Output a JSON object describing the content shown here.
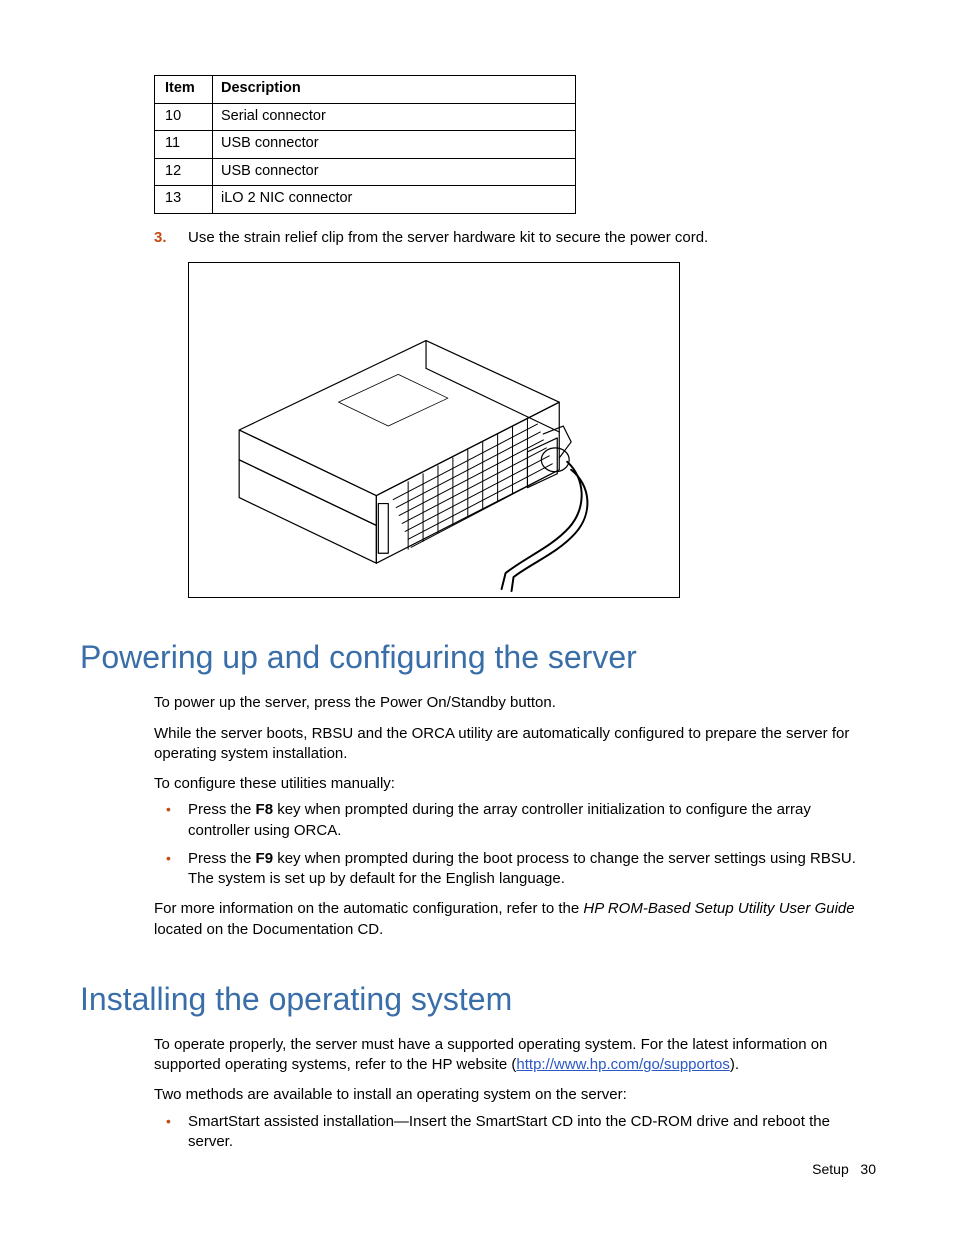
{
  "table": {
    "headers": {
      "item": "Item",
      "description": "Description"
    },
    "rows": [
      {
        "item": "10",
        "description": "Serial connector"
      },
      {
        "item": "11",
        "description": "USB connector"
      },
      {
        "item": "12",
        "description": "USB connector"
      },
      {
        "item": "13",
        "description": "iLO 2 NIC connector"
      }
    ]
  },
  "step3": {
    "num": "3.",
    "text": "Use the strain relief clip from the server hardware kit to secure the power cord."
  },
  "section1": {
    "title": "Powering up and configuring the server",
    "p1": "To power up the server, press the Power On/Standby button.",
    "p2": "While the server boots, RBSU and the ORCA utility are automatically configured to prepare the server for operating system installation.",
    "p3": "To configure these utilities manually:",
    "bullets": [
      {
        "pre": "Press the ",
        "key": "F8",
        "post": " key when prompted during the array controller initialization to configure the array controller using ORCA."
      },
      {
        "pre": "Press the ",
        "key": "F9",
        "post": " key when prompted during the boot process to change the server settings using RBSU. The system is set up by default for the English language."
      }
    ],
    "p4a": "For more information on the automatic configuration, refer to the ",
    "p4b": "HP ROM-Based Setup Utility User Guide",
    "p4c": " located on the Documentation CD."
  },
  "section2": {
    "title": "Installing the operating system",
    "p1a": "To operate properly, the server must have a supported operating system. For the latest information on supported operating systems, refer to the HP website (",
    "link": "http://www.hp.com/go/supportos",
    "p1b": ").",
    "p2": "Two methods are available to install an operating system on the server:",
    "bullets": [
      "SmartStart assisted installation—Insert the SmartStart CD into the CD-ROM drive and reboot the server."
    ]
  },
  "footer": {
    "section": "Setup",
    "page": "30"
  }
}
